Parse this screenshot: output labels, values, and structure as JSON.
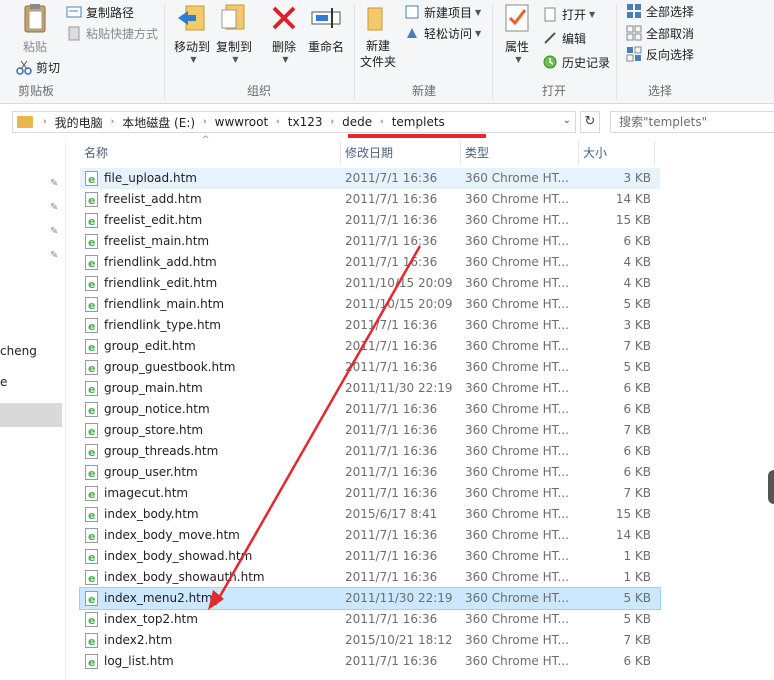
{
  "ribbon": {
    "clipboard": {
      "paste": "粘贴",
      "copy_path": "复制路径",
      "paste_shortcut": "粘贴快捷方式",
      "cut": "剪切",
      "group": "剪贴板"
    },
    "organize": {
      "move_to": "移动到",
      "copy_to": "复制到",
      "delete": "删除",
      "rename": "重命名",
      "group": "组织"
    },
    "new": {
      "new_folder": "新建\n文件夹",
      "new_item": "新建项目",
      "easy_access": "轻松访问",
      "group": "新建"
    },
    "open": {
      "properties": "属性",
      "open": "打开",
      "edit": "编辑",
      "history": "历史记录",
      "group": "打开"
    },
    "select": {
      "select_all": "全部选择",
      "select_none": "全部取消",
      "invert": "反向选择",
      "group": "选择"
    }
  },
  "address": {
    "crumbs": [
      "我的电脑",
      "本地磁盘 (E:)",
      "wwwroot",
      "tx123",
      "dede",
      "templets"
    ],
    "search_placeholder": "搜索\"templets\""
  },
  "nav": {
    "items": [
      "cheng",
      "e"
    ]
  },
  "columns": {
    "name": "名称",
    "date": "修改日期",
    "type": "类型",
    "size": "大小"
  },
  "files": [
    {
      "name": "file_upload.htm",
      "date": "2011/7/1 16:36",
      "type": "360 Chrome HT...",
      "size": "3 KB"
    },
    {
      "name": "freelist_add.htm",
      "date": "2011/7/1 16:36",
      "type": "360 Chrome HT...",
      "size": "14 KB"
    },
    {
      "name": "freelist_edit.htm",
      "date": "2011/7/1 16:36",
      "type": "360 Chrome HT...",
      "size": "15 KB"
    },
    {
      "name": "freelist_main.htm",
      "date": "2011/7/1 16:36",
      "type": "360 Chrome HT...",
      "size": "6 KB"
    },
    {
      "name": "friendlink_add.htm",
      "date": "2011/7/1 16:36",
      "type": "360 Chrome HT...",
      "size": "4 KB"
    },
    {
      "name": "friendlink_edit.htm",
      "date": "2011/10/15 20:09",
      "type": "360 Chrome HT...",
      "size": "4 KB"
    },
    {
      "name": "friendlink_main.htm",
      "date": "2011/10/15 20:09",
      "type": "360 Chrome HT...",
      "size": "5 KB"
    },
    {
      "name": "friendlink_type.htm",
      "date": "2011/7/1 16:36",
      "type": "360 Chrome HT...",
      "size": "3 KB"
    },
    {
      "name": "group_edit.htm",
      "date": "2011/7/1 16:36",
      "type": "360 Chrome HT...",
      "size": "7 KB"
    },
    {
      "name": "group_guestbook.htm",
      "date": "2011/7/1 16:36",
      "type": "360 Chrome HT...",
      "size": "5 KB"
    },
    {
      "name": "group_main.htm",
      "date": "2011/11/30 22:19",
      "type": "360 Chrome HT...",
      "size": "6 KB"
    },
    {
      "name": "group_notice.htm",
      "date": "2011/7/1 16:36",
      "type": "360 Chrome HT...",
      "size": "6 KB"
    },
    {
      "name": "group_store.htm",
      "date": "2011/7/1 16:36",
      "type": "360 Chrome HT...",
      "size": "7 KB"
    },
    {
      "name": "group_threads.htm",
      "date": "2011/7/1 16:36",
      "type": "360 Chrome HT...",
      "size": "6 KB"
    },
    {
      "name": "group_user.htm",
      "date": "2011/7/1 16:36",
      "type": "360 Chrome HT...",
      "size": "6 KB"
    },
    {
      "name": "imagecut.htm",
      "date": "2011/7/1 16:36",
      "type": "360 Chrome HT...",
      "size": "7 KB"
    },
    {
      "name": "index_body.htm",
      "date": "2015/6/17 8:41",
      "type": "360 Chrome HT...",
      "size": "15 KB"
    },
    {
      "name": "index_body_move.htm",
      "date": "2011/7/1 16:36",
      "type": "360 Chrome HT...",
      "size": "14 KB"
    },
    {
      "name": "index_body_showad.htm",
      "date": "2011/7/1 16:36",
      "type": "360 Chrome HT...",
      "size": "1 KB"
    },
    {
      "name": "index_body_showauth.htm",
      "date": "2011/7/1 16:36",
      "type": "360 Chrome HT...",
      "size": "1 KB"
    },
    {
      "name": "index_menu2.htm",
      "date": "2011/11/30 22:19",
      "type": "360 Chrome HT...",
      "size": "5 KB"
    },
    {
      "name": "index_top2.htm",
      "date": "2011/7/1 16:36",
      "type": "360 Chrome HT...",
      "size": "5 KB"
    },
    {
      "name": "index2.htm",
      "date": "2015/10/21 18:12",
      "type": "360 Chrome HT...",
      "size": "7 KB"
    },
    {
      "name": "log_list.htm",
      "date": "2011/7/1 16:36",
      "type": "360 Chrome HT...",
      "size": "6 KB"
    }
  ],
  "selected_file": "index_menu2.htm",
  "hover_file": "file_upload.htm",
  "colors": {
    "annotation": "#e3292e",
    "selection": "#cce8ff",
    "hover": "#e5f3ff",
    "folder": "#e8b84a"
  }
}
